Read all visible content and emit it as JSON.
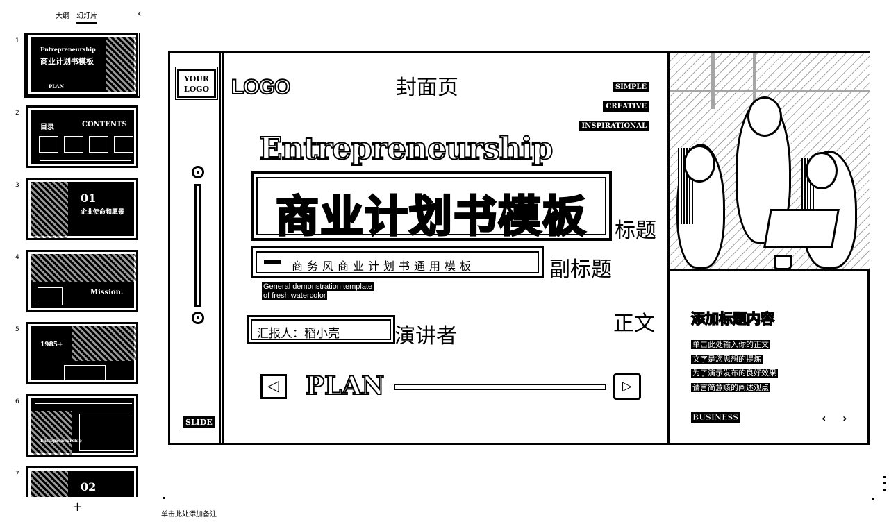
{
  "left_panel": {
    "tab_outline": "大纲",
    "tab_slides": "幻灯片",
    "collapse_icon": "‹",
    "add_icon": "+",
    "thumbnails": [
      {
        "number": "1",
        "lines": [
          "Entrepreneurship",
          "商业计划书模板",
          "PLAN"
        ]
      },
      {
        "number": "2",
        "lines": [
          "目录",
          "CONTENTS"
        ]
      },
      {
        "number": "3",
        "lines": [
          "01",
          "企业使命和愿景"
        ]
      },
      {
        "number": "4",
        "lines": [
          "Mission."
        ]
      },
      {
        "number": "5",
        "lines": [
          "1985+"
        ]
      },
      {
        "number": "6",
        "lines": [
          "Entrepreneurship"
        ]
      },
      {
        "number": "7",
        "lines": [
          "02"
        ]
      }
    ]
  },
  "slide": {
    "logo_box": [
      "YOUR",
      "LOGO"
    ],
    "logo_text": "LOGO",
    "annot_cover": "封面页",
    "tags": [
      "SIMPLE",
      "CREATIVE",
      "INSPIRATIONAL"
    ],
    "title_en": "Entrepreneurship",
    "title_cn": "商业计划书模板",
    "annot_title": "标题",
    "subtitle_cn": "商务风商业计划书通用模板",
    "annot_subtitle": "副标题",
    "subtitle_en_1": "General demonstration template",
    "subtitle_en_2": "of fresh watercolor",
    "presenter": "汇报人：稻小壳",
    "annot_presenter": "演讲者",
    "annot_body": "正文",
    "plan": "PLAN",
    "slide_label": "SLIDE",
    "side_title": "添加标题内容",
    "side_body": [
      "单击此处输入你的正文",
      "文字是您思想的提炼",
      "为了演示发布的良好效果",
      "请言简意赅的阐述观点"
    ],
    "business": "BUSINESS",
    "nav_prev": "‹",
    "nav_next": "›"
  },
  "notes": {
    "placeholder": "单击此处添加备注"
  }
}
